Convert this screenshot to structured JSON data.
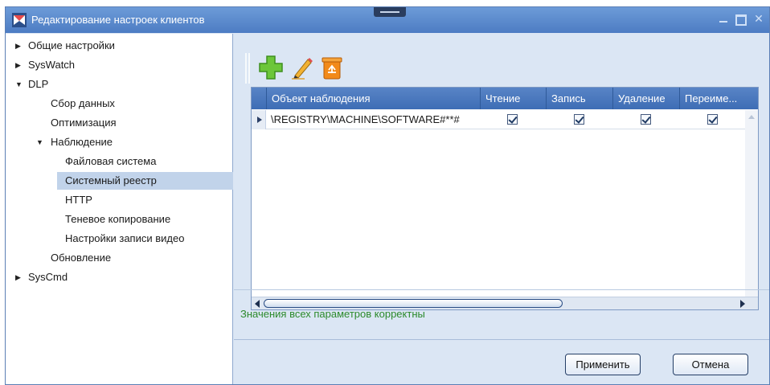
{
  "window": {
    "title": "Редактирование настроек клиентов"
  },
  "tree": {
    "items": [
      {
        "label": "Общие настройки"
      },
      {
        "label": "SysWatch"
      },
      {
        "label": "DLP"
      },
      {
        "label": "Сбор данных"
      },
      {
        "label": "Оптимизация"
      },
      {
        "label": "Наблюдение"
      },
      {
        "label": "Файловая система"
      },
      {
        "label": "Системный реестр"
      },
      {
        "label": "HTTP"
      },
      {
        "label": "Теневое копирование"
      },
      {
        "label": "Настройки записи видео"
      },
      {
        "label": "Обновление"
      },
      {
        "label": "SysCmd"
      }
    ],
    "selected": "Системный реестр"
  },
  "toolbar": {
    "icons": [
      "add-icon",
      "edit-icon",
      "delete-icon"
    ]
  },
  "grid": {
    "columns": [
      "Объект наблюдения",
      "Чтение",
      "Запись",
      "Удаление",
      "Переиме..."
    ],
    "rows": [
      {
        "object": "\\REGISTRY\\MACHINE\\SOFTWARE#**#",
        "read": true,
        "write": true,
        "delete": true,
        "rename": true
      }
    ]
  },
  "status": {
    "message": "Значения всех параметров корректны",
    "color": "#2c8a2c"
  },
  "buttons": {
    "apply": "Применить",
    "cancel": "Отмена"
  }
}
